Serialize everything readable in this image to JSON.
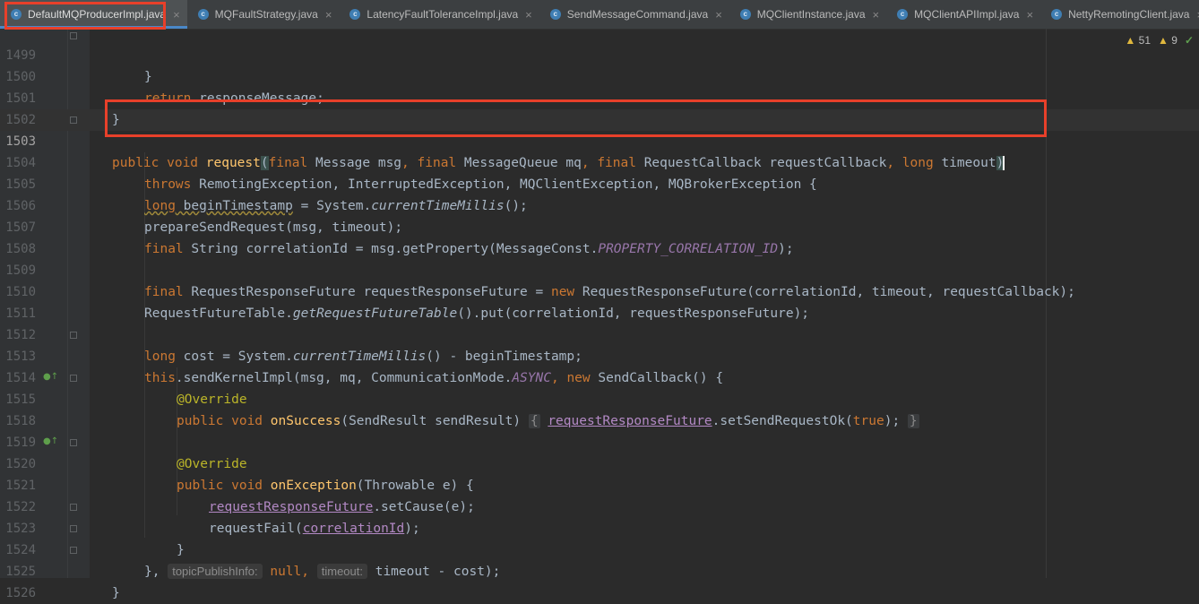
{
  "tabs": [
    {
      "label": "DefaultMQProducerImpl.java",
      "active": true
    },
    {
      "label": "MQFaultStrategy.java"
    },
    {
      "label": "LatencyFaultToleranceImpl.java"
    },
    {
      "label": "SendMessageCommand.java"
    },
    {
      "label": "MQClientInstance.java"
    },
    {
      "label": "MQClientAPIImpl.java"
    },
    {
      "label": "NettyRemotingClient.java"
    },
    {
      "label": "DefaultMQPro"
    }
  ],
  "tab_icon_glyph": "c",
  "tab_close_glyph": "×",
  "inspection": {
    "warnings": "51",
    "weak_warnings": "9"
  },
  "lines": [
    {
      "n": "1499"
    },
    {
      "n": "1500"
    },
    {
      "n": "1501"
    },
    {
      "n": "1502"
    },
    {
      "n": "1503"
    },
    {
      "n": "1504"
    },
    {
      "n": "1505"
    },
    {
      "n": "1506"
    },
    {
      "n": "1507"
    },
    {
      "n": "1508"
    },
    {
      "n": "1509"
    },
    {
      "n": "1510"
    },
    {
      "n": "1511"
    },
    {
      "n": "1512"
    },
    {
      "n": "1513"
    },
    {
      "n": "1514"
    },
    {
      "n": "1515"
    },
    {
      "n": "1518"
    },
    {
      "n": "1519"
    },
    {
      "n": "1520"
    },
    {
      "n": "1521"
    },
    {
      "n": "1522"
    },
    {
      "n": "1523"
    },
    {
      "n": "1524"
    },
    {
      "n": "1525"
    },
    {
      "n": "1526"
    }
  ],
  "code": {
    "l1499": "}",
    "l1500_kw": "return",
    "l1500_rest": " responseMessage;",
    "l1501": "}",
    "l1503_kw1": "public void ",
    "l1503_fn": "request",
    "l1503_p1": "(",
    "l1503_kw2": "final",
    "l1503_t1": " Message msg",
    "l1503_c1": ", ",
    "l1503_kw3": "final",
    "l1503_t2": " MessageQueue mq",
    "l1503_c2": ", ",
    "l1503_kw4": "final",
    "l1503_t3": " RequestCallback requestCallback",
    "l1503_c3": ", ",
    "l1503_kw5": "long",
    "l1503_t4": " timeout",
    "l1503_p2": ")",
    "l1504_kw": "throws",
    "l1504_rest": " RemotingException, InterruptedException, MQClientException, MQBrokerException {",
    "l1505_kw": "long",
    "l1505_var": " beginTimestamp",
    "l1505_mid": " = System.",
    "l1505_it": "currentTimeMillis",
    "l1505_end": "();",
    "l1506": "prepareSendRequest(msg, timeout);",
    "l1507_kw": "final",
    "l1507_mid": " String correlationId = msg.getProperty(MessageConst.",
    "l1507_const": "PROPERTY_CORRELATION_ID",
    "l1507_end": ");",
    "l1509_kw": "final",
    "l1509_mid": " RequestResponseFuture requestResponseFuture = ",
    "l1509_kw2": "new",
    "l1509_end": " RequestResponseFuture(correlationId, timeout, requestCallback);",
    "l1510_a": "RequestFutureTable.",
    "l1510_it": "getRequestFutureTable",
    "l1510_b": "().put(correlationId, requestResponseFuture);",
    "l1512_kw": "long",
    "l1512_mid": " cost = System.",
    "l1512_it": "currentTimeMillis",
    "l1512_end": "() - beginTimestamp;",
    "l1513_kw": "this",
    "l1513_mid": ".sendKernelImpl(msg, mq, CommunicationMode.",
    "l1513_const": "ASYNC",
    "l1513_c": ", ",
    "l1513_kw2": "new",
    "l1513_end": " SendCallback() {",
    "l1514": "@Override",
    "l1515_kw": "public void ",
    "l1515_fn": "onSuccess",
    "l1515_mid": "(SendResult sendResult) ",
    "l1515_b1": "{",
    "l1515_field": "requestResponseFuture",
    "l1515_call": ".setSendRequestOk(",
    "l1515_kw2": "true",
    "l1515_end": "); ",
    "l1515_b2": "}",
    "l1519": "@Override",
    "l1520_kw": "public void ",
    "l1520_fn": "onException",
    "l1520_end": "(Throwable e) {",
    "l1521_field": "requestResponseFuture",
    "l1521_end": ".setCause(e);",
    "l1522_a": "requestFail(",
    "l1522_field": "correlationId",
    "l1522_end": ");",
    "l1523": "}",
    "l1524_a": "}, ",
    "l1524_hint1": "topicPublishInfo:",
    "l1524_kw": "null",
    "l1524_c": ", ",
    "l1524_hint2": "timeout:",
    "l1524_end": "timeout - cost);",
    "l1525": "}"
  }
}
